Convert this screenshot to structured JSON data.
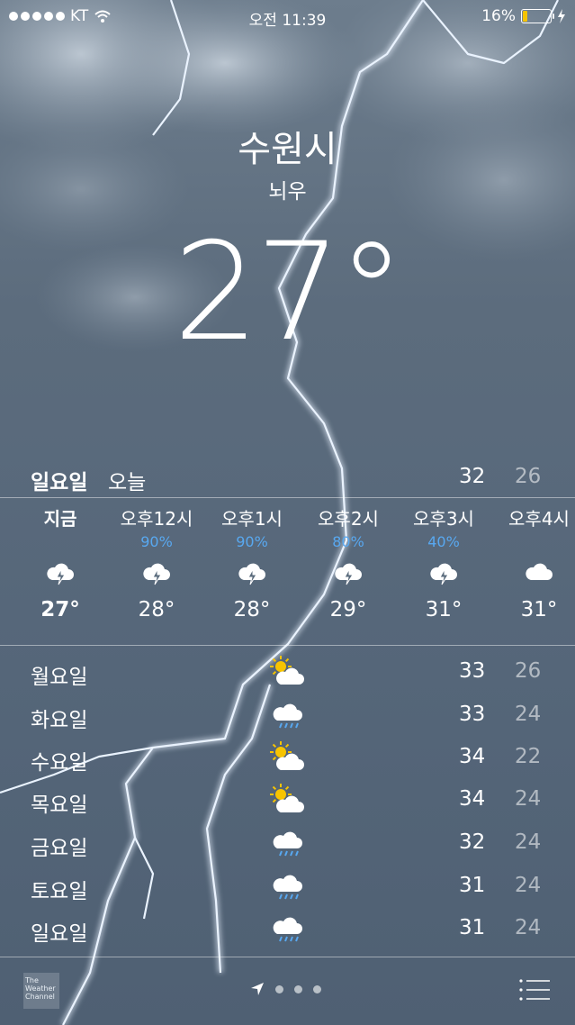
{
  "status": {
    "carrier": "KT",
    "time": "오전 11:39",
    "battery": "16%"
  },
  "location": {
    "city": "수원시",
    "condition": "뇌우",
    "temperature": "27°"
  },
  "today": {
    "day": "일요일",
    "label": "오늘",
    "high": "32",
    "low": "26"
  },
  "hourly": [
    {
      "time": "지금",
      "precip": "",
      "icon": "thunderstorm-icon",
      "temp": "27°"
    },
    {
      "time": "오후12시",
      "precip": "90%",
      "icon": "thunderstorm-icon",
      "temp": "28°"
    },
    {
      "time": "오후1시",
      "precip": "90%",
      "icon": "thunderstorm-icon",
      "temp": "28°"
    },
    {
      "time": "오후2시",
      "precip": "80%",
      "icon": "thunderstorm-icon",
      "temp": "29°"
    },
    {
      "time": "오후3시",
      "precip": "40%",
      "icon": "thunderstorm-icon",
      "temp": "31°"
    },
    {
      "time": "오후4시",
      "precip": "",
      "icon": "cloud-icon",
      "temp": "31°"
    }
  ],
  "daily": [
    {
      "day": "월요일",
      "icon": "partly-sunny-icon",
      "high": "33",
      "low": "26"
    },
    {
      "day": "화요일",
      "icon": "rain-icon",
      "high": "33",
      "low": "24"
    },
    {
      "day": "수요일",
      "icon": "partly-sunny-icon",
      "high": "34",
      "low": "22"
    },
    {
      "day": "목요일",
      "icon": "partly-sunny-icon",
      "high": "34",
      "low": "24"
    },
    {
      "day": "금요일",
      "icon": "rain-icon",
      "high": "32",
      "low": "24"
    },
    {
      "day": "토요일",
      "icon": "rain-icon",
      "high": "31",
      "low": "24"
    },
    {
      "day": "일요일",
      "icon": "rain-icon",
      "high": "31",
      "low": "24"
    }
  ],
  "footer": {
    "brand": "The Weather Channel"
  },
  "colors": {
    "precip": "#58a8f0",
    "sun": "#f7c400",
    "battery": "#f7c400"
  }
}
